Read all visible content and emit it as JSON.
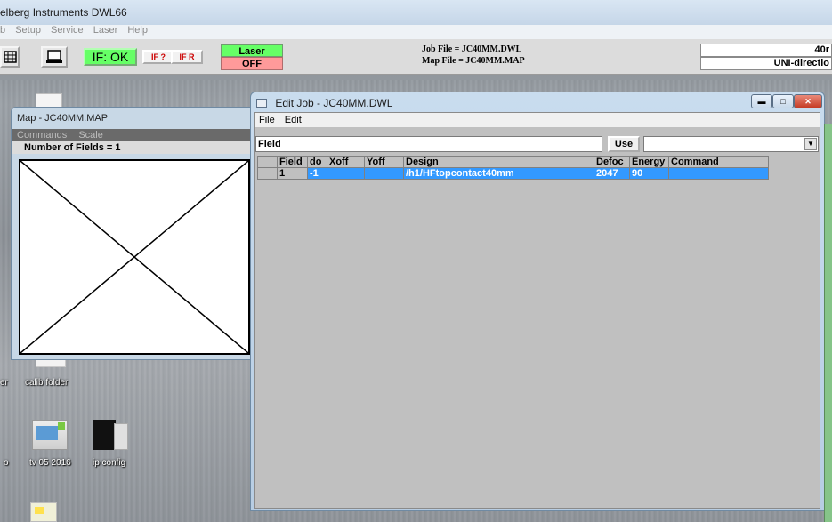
{
  "app": {
    "title": "elberg Instruments DWL66",
    "menu": [
      "b",
      "Setup",
      "Service",
      "Laser",
      "Help"
    ],
    "if_status": "IF: OK",
    "if_query": "IF ?",
    "if_reset": "IF R",
    "laser_label": "Laser",
    "laser_state": "OFF",
    "job_file": "Job File = JC40MM.DWL",
    "map_file": "Map File = JC40MM.MAP",
    "right_top": "40r",
    "right_bottom": "UNI-directio"
  },
  "map_window": {
    "title": "Map - JC40MM.MAP",
    "menu": [
      "Commands",
      "Scale"
    ],
    "info": "Number of Fields = 1"
  },
  "desktop": {
    "icons": [
      {
        "label": "er"
      },
      {
        "label": "calib folder"
      },
      {
        "label": "o"
      },
      {
        "label": "tv 05 2016"
      },
      {
        "label": "ip config"
      }
    ]
  },
  "edit_window": {
    "title": "Edit Job - JC40MM.DWL",
    "menu": [
      "File",
      "Edit"
    ],
    "field_value": "Field",
    "use_label": "Use",
    "columns": [
      "Field",
      "do",
      "Xoff",
      "Yoff",
      "Design",
      "Defoc",
      "Energy",
      "Command"
    ],
    "rows": [
      {
        "field": "1",
        "do": "-1",
        "xoff": "",
        "yoff": "",
        "design": "/h1/HFtopcontact40mm",
        "defoc": "2047",
        "energy": "90",
        "command": ""
      }
    ]
  }
}
